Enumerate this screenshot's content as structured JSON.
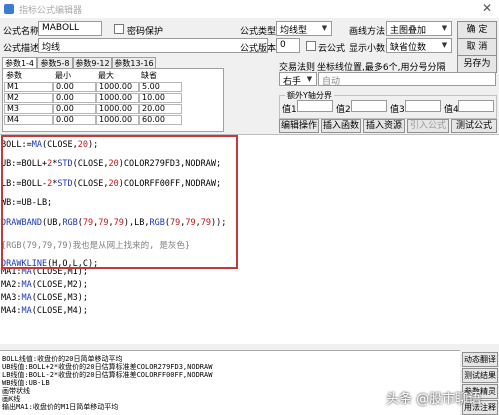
{
  "window": {
    "title": "指标公式编辑器",
    "close_glyph": "✕"
  },
  "form": {
    "name_label": "公式名称",
    "name_value": "MABOLL",
    "password_label": "密码保护",
    "desc_label": "公式描述",
    "desc_value": "均线",
    "type_label": "公式类型",
    "type_value": "均线型",
    "draw_label": "画线方法",
    "draw_value": "主图叠加",
    "version_label": "公式版本",
    "version_value": "0",
    "cloud_label": "云公式",
    "decimals_label": "显示小数",
    "decimals_value": "缺省位数"
  },
  "buttons": {
    "confirm": "确 定",
    "cancel": "取 消",
    "save_as": "另存为",
    "edit_ops": "编辑操作",
    "insert_func": "插入函数",
    "insert_res": "插入资源",
    "import_formula": "引入公式",
    "test_formula": "测试公式"
  },
  "tabs": [
    {
      "label": "参数1-4",
      "active": true
    },
    {
      "label": "参数5-8",
      "active": false
    },
    {
      "label": "参数9-12",
      "active": false
    },
    {
      "label": "参数13-16",
      "active": false
    }
  ],
  "params": {
    "headers": [
      "参数",
      "最小",
      "最大",
      "缺省"
    ],
    "rows": [
      [
        "M1",
        "0.00",
        "1000.00",
        "5.00"
      ],
      [
        "M2",
        "0.00",
        "1000.00",
        "10.00"
      ],
      [
        "M3",
        "0.00",
        "1000.00",
        "20.00"
      ],
      [
        "M4",
        "0.00",
        "1000.00",
        "60.00"
      ]
    ]
  },
  "trade": {
    "rule_label": "交易法则",
    "coord_hint": "坐标线位置,最多6个,用分号分隔",
    "hand_value": "右手",
    "auto_value": "自动"
  },
  "axis_group": {
    "label": "额外Y轴分界",
    "v1": "值1",
    "v2": "值2",
    "v3": "值3",
    "v4": "值4"
  },
  "code": {
    "lines": [
      [
        {
          "t": "BOLL:=",
          "c": ""
        },
        {
          "t": "MA",
          "c": "kw"
        },
        {
          "t": "(CLOSE,",
          "c": ""
        },
        {
          "t": "20",
          "c": "num"
        },
        {
          "t": ");",
          "c": ""
        }
      ],
      [
        {
          "t": "UB:=BOLL+",
          "c": ""
        },
        {
          "t": "2",
          "c": "num"
        },
        {
          "t": "*",
          "c": ""
        },
        {
          "t": "STD",
          "c": "kw"
        },
        {
          "t": "(CLOSE,",
          "c": ""
        },
        {
          "t": "20",
          "c": "num"
        },
        {
          "t": ")COLOR279FD3,NODRAW;",
          "c": ""
        }
      ],
      [
        {
          "t": "LB:=BOLL-",
          "c": ""
        },
        {
          "t": "2",
          "c": "num"
        },
        {
          "t": "*",
          "c": ""
        },
        {
          "t": "STD",
          "c": "kw"
        },
        {
          "t": "(CLOSE,",
          "c": ""
        },
        {
          "t": "20",
          "c": "num"
        },
        {
          "t": ")COLORFF00FF,NODRAW;",
          "c": ""
        }
      ],
      [
        {
          "t": "WB:=UB-LB;",
          "c": ""
        }
      ],
      [
        {
          "t": "DRAWBAND",
          "c": "kw"
        },
        {
          "t": "(UB,",
          "c": ""
        },
        {
          "t": "RGB",
          "c": "kw"
        },
        {
          "t": "(",
          "c": ""
        },
        {
          "t": "79",
          "c": "num"
        },
        {
          "t": ",",
          "c": ""
        },
        {
          "t": "79",
          "c": "num"
        },
        {
          "t": ",",
          "c": ""
        },
        {
          "t": "79",
          "c": "num"
        },
        {
          "t": "),LB,",
          "c": ""
        },
        {
          "t": "RGB",
          "c": "kw"
        },
        {
          "t": "(",
          "c": ""
        },
        {
          "t": "79",
          "c": "num"
        },
        {
          "t": ",",
          "c": ""
        },
        {
          "t": "79",
          "c": "num"
        },
        {
          "t": ",",
          "c": ""
        },
        {
          "t": "79",
          "c": "num"
        },
        {
          "t": "));",
          "c": ""
        }
      ],
      [
        {
          "t": "{RGB(79,79,79)我也是从网上找来的, 是灰色}",
          "c": "cmt"
        }
      ],
      [
        {
          "t": "DRAWKLINE",
          "c": "kw"
        },
        {
          "t": "(H,O,L,C);",
          "c": ""
        }
      ],
      [
        {
          "t": "MA1:",
          "c": ""
        },
        {
          "t": "MA",
          "c": "kw"
        },
        {
          "t": "(CLOSE,M1);",
          "c": ""
        }
      ],
      [
        {
          "t": "MA2:",
          "c": ""
        },
        {
          "t": "MA",
          "c": "kw"
        },
        {
          "t": "(CLOSE,M2);",
          "c": ""
        }
      ],
      [
        {
          "t": "MA3:",
          "c": ""
        },
        {
          "t": "MA",
          "c": "kw"
        },
        {
          "t": "(CLOSE,M3);",
          "c": ""
        }
      ],
      [
        {
          "t": "MA4:",
          "c": ""
        },
        {
          "t": "MA",
          "c": "kw"
        },
        {
          "t": "(CLOSE,M4);",
          "c": ""
        }
      ]
    ]
  },
  "output": {
    "lines": [
      "BOLL线值:收盘价的20日简单移动平均",
      "UB线值:BOLL+2*收盘价的20日估算标准差COLOR279FD3,NODRAW",
      "LB线值:BOLL-2*收盘价的20日估算标准差COLORFF00FF,NODRAW",
      "WB线值:UB-LB",
      "画带状线",
      "画K线",
      "输出MA1:收盘价的M1日简单移动平均"
    ]
  },
  "side_buttons": [
    "动态翻译",
    "测试结果",
    "参数精灵",
    "用法注释"
  ],
  "watermark": "头条 @股市聊语"
}
